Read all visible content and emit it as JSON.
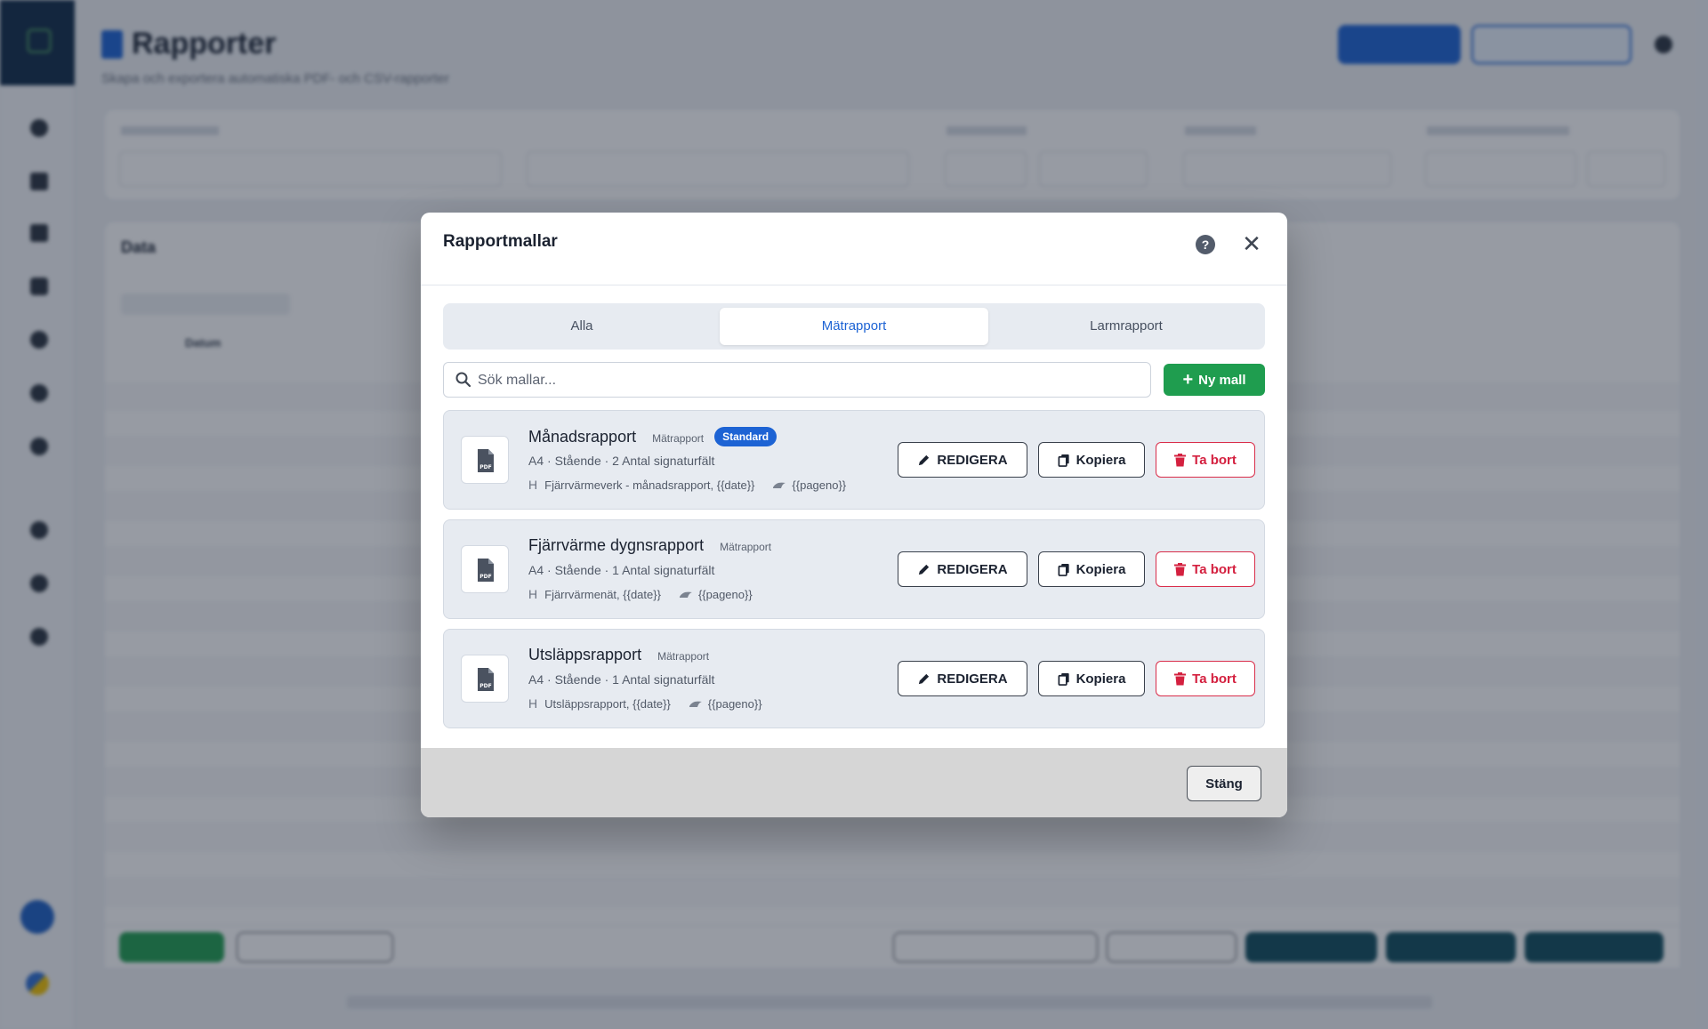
{
  "background": {
    "page_title": "Rapporter",
    "page_subtitle": "Skapa och exportera automatiska PDF- och CSV-rapporter",
    "data_title": "Data",
    "date_col_label": "Datum"
  },
  "modal": {
    "title": "Rapportmallar",
    "help_glyph": "?",
    "close_glyph": "✕",
    "tabs": [
      {
        "label": "Alla",
        "active": false
      },
      {
        "label": "Mätrapport",
        "active": true
      },
      {
        "label": "Larmrapport",
        "active": false
      }
    ],
    "search": {
      "placeholder": "Sök mallar...",
      "value": ""
    },
    "new_button_label": "Ny mall",
    "templates": [
      {
        "name": "Månadsrapport",
        "type": "Mätrapport",
        "badge": "Standard",
        "meta": "A4 · Stående · 2 Antal signaturfält",
        "header_text": "Fjärrvärmeverk - månadsrapport, {{date}}",
        "footer_text": "{{pageno}}"
      },
      {
        "name": "Fjärrvärme dygnsrapport",
        "type": "Mätrapport",
        "badge": "",
        "meta": "A4 · Stående · 1 Antal signaturfält",
        "header_text": "Fjärrvärmenät, {{date}}",
        "footer_text": "{{pageno}}"
      },
      {
        "name": "Utsläppsrapport",
        "type": "Mätrapport",
        "badge": "",
        "meta": "A4 · Stående · 1 Antal signaturfält",
        "header_text": "Utsläppsrapport, {{date}}",
        "footer_text": "{{pageno}}"
      }
    ],
    "buttons": {
      "edit": "REDIGERA",
      "copy": "Kopiera",
      "delete": "Ta bort"
    },
    "close_button_label": "Stäng"
  },
  "colors": {
    "accent": "#1d63d4",
    "success": "#1f9d4f",
    "danger": "#d4203f",
    "overlay": "rgba(24,33,52,0.45)"
  },
  "icons": {
    "template_icon": "pdf-file-icon",
    "search": "search-icon",
    "edit": "pencil-icon",
    "copy": "copy-icon",
    "delete": "trash-icon",
    "help": "help-icon",
    "close": "close-icon",
    "header_marker": "heading-icon",
    "footer_marker": "footer-icon"
  }
}
